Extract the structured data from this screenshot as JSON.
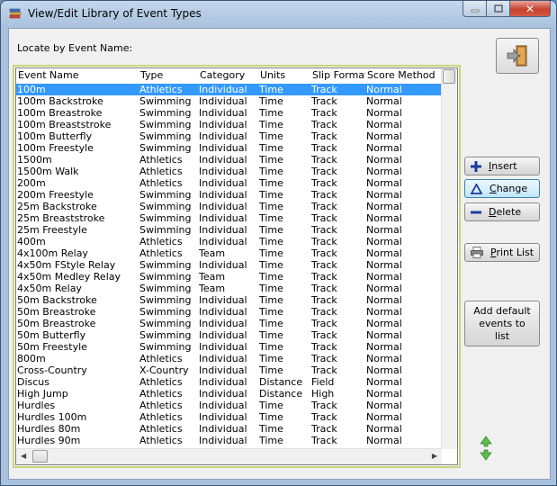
{
  "window": {
    "title": "View/Edit Library of Event Types",
    "close_glyph": "✕"
  },
  "locate": {
    "label": "Locate by Event Name:"
  },
  "grid": {
    "columns": [
      "Event Name",
      "Type",
      "Category",
      "Units",
      "Slip Format",
      "Score Method"
    ],
    "selected_index": 0,
    "rows": [
      [
        "100m",
        "Athletics",
        "Individual",
        "Time",
        "Track",
        "Normal"
      ],
      [
        "100m Backstroke",
        "Swimming",
        "Individual",
        "Time",
        "Track",
        "Normal"
      ],
      [
        "100m Breastroke",
        "Swimming",
        "Individual",
        "Time",
        "Track",
        "Normal"
      ],
      [
        "100m Breaststroke",
        "Swimming",
        "Individual",
        "Time",
        "Track",
        "Normal"
      ],
      [
        "100m Butterfly",
        "Swimming",
        "Individual",
        "Time",
        "Track",
        "Normal"
      ],
      [
        "100m Freestyle",
        "Swimming",
        "Individual",
        "Time",
        "Track",
        "Normal"
      ],
      [
        "1500m",
        "Athletics",
        "Individual",
        "Time",
        "Track",
        "Normal"
      ],
      [
        "1500m Walk",
        "Athletics",
        "Individual",
        "Time",
        "Track",
        "Normal"
      ],
      [
        "200m",
        "Athletics",
        "Individual",
        "Time",
        "Track",
        "Normal"
      ],
      [
        "200m Freestyle",
        "Swimming",
        "Individual",
        "Time",
        "Track",
        "Normal"
      ],
      [
        "25m Backstroke",
        "Swimming",
        "Individual",
        "Time",
        "Track",
        "Normal"
      ],
      [
        "25m Breaststroke",
        "Swimming",
        "Individual",
        "Time",
        "Track",
        "Normal"
      ],
      [
        "25m Freestyle",
        "Swimming",
        "Individual",
        "Time",
        "Track",
        "Normal"
      ],
      [
        "400m",
        "Athletics",
        "Individual",
        "Time",
        "Track",
        "Normal"
      ],
      [
        "4x100m Relay",
        "Athletics",
        "Team",
        "Time",
        "Track",
        "Normal"
      ],
      [
        "4x50m FStyle Relay",
        "Swimming",
        "Individual",
        "Time",
        "Track",
        "Normal"
      ],
      [
        "4x50m Medley Relay",
        "Swimming",
        "Team",
        "Time",
        "Track",
        "Normal"
      ],
      [
        "4x50m Relay",
        "Swimming",
        "Team",
        "Time",
        "Track",
        "Normal"
      ],
      [
        "50m Backstroke",
        "Swimming",
        "Individual",
        "Time",
        "Track",
        "Normal"
      ],
      [
        "50m Breastroke",
        "Swimming",
        "Individual",
        "Time",
        "Track",
        "Normal"
      ],
      [
        "50m Breastroke",
        "Swimming",
        "Individual",
        "Time",
        "Track",
        "Normal"
      ],
      [
        "50m Butterfly",
        "Swimming",
        "Individual",
        "Time",
        "Track",
        "Normal"
      ],
      [
        "50m Freestyle",
        "Swimming",
        "Individual",
        "Time",
        "Track",
        "Normal"
      ],
      [
        "800m",
        "Athletics",
        "Individual",
        "Time",
        "Track",
        "Normal"
      ],
      [
        "Cross-Country",
        "X-Country",
        "Individual",
        "Time",
        "Track",
        "Normal"
      ],
      [
        "Discus",
        "Athletics",
        "Individual",
        "Distance",
        "Field",
        "Normal"
      ],
      [
        "High Jump",
        "Athletics",
        "Individual",
        "Distance",
        "High",
        "Normal"
      ],
      [
        "Hurdles",
        "Athletics",
        "Individual",
        "Time",
        "Track",
        "Normal"
      ],
      [
        "Hurdles 100m",
        "Athletics",
        "Individual",
        "Time",
        "Track",
        "Normal"
      ],
      [
        "Hurdles 80m",
        "Athletics",
        "Individual",
        "Time",
        "Track",
        "Normal"
      ],
      [
        "Hurdles 90m",
        "Athletics",
        "Individual",
        "Time",
        "Track",
        "Normal"
      ]
    ]
  },
  "buttons": {
    "insert_u": "I",
    "insert_rest": "nsert",
    "change_u": "C",
    "change_rest": "hange",
    "delete_u": "D",
    "delete_rest": "elete",
    "print_u": "P",
    "print_rest": "rint List",
    "add_default": "Add default events to list"
  },
  "colors": {
    "selection": "#3399ff",
    "grid_focus_border": "#c9d47a",
    "insert_icon": "#1a3a9c",
    "sort_icon": "#4caf50"
  },
  "icons": {
    "app": "book-stack-icon",
    "exit": "exit-door-icon",
    "insert": "plus-icon",
    "change": "triangle-icon",
    "delete": "minus-icon",
    "print": "printer-icon",
    "sort": "up-down-arrows-icon"
  }
}
